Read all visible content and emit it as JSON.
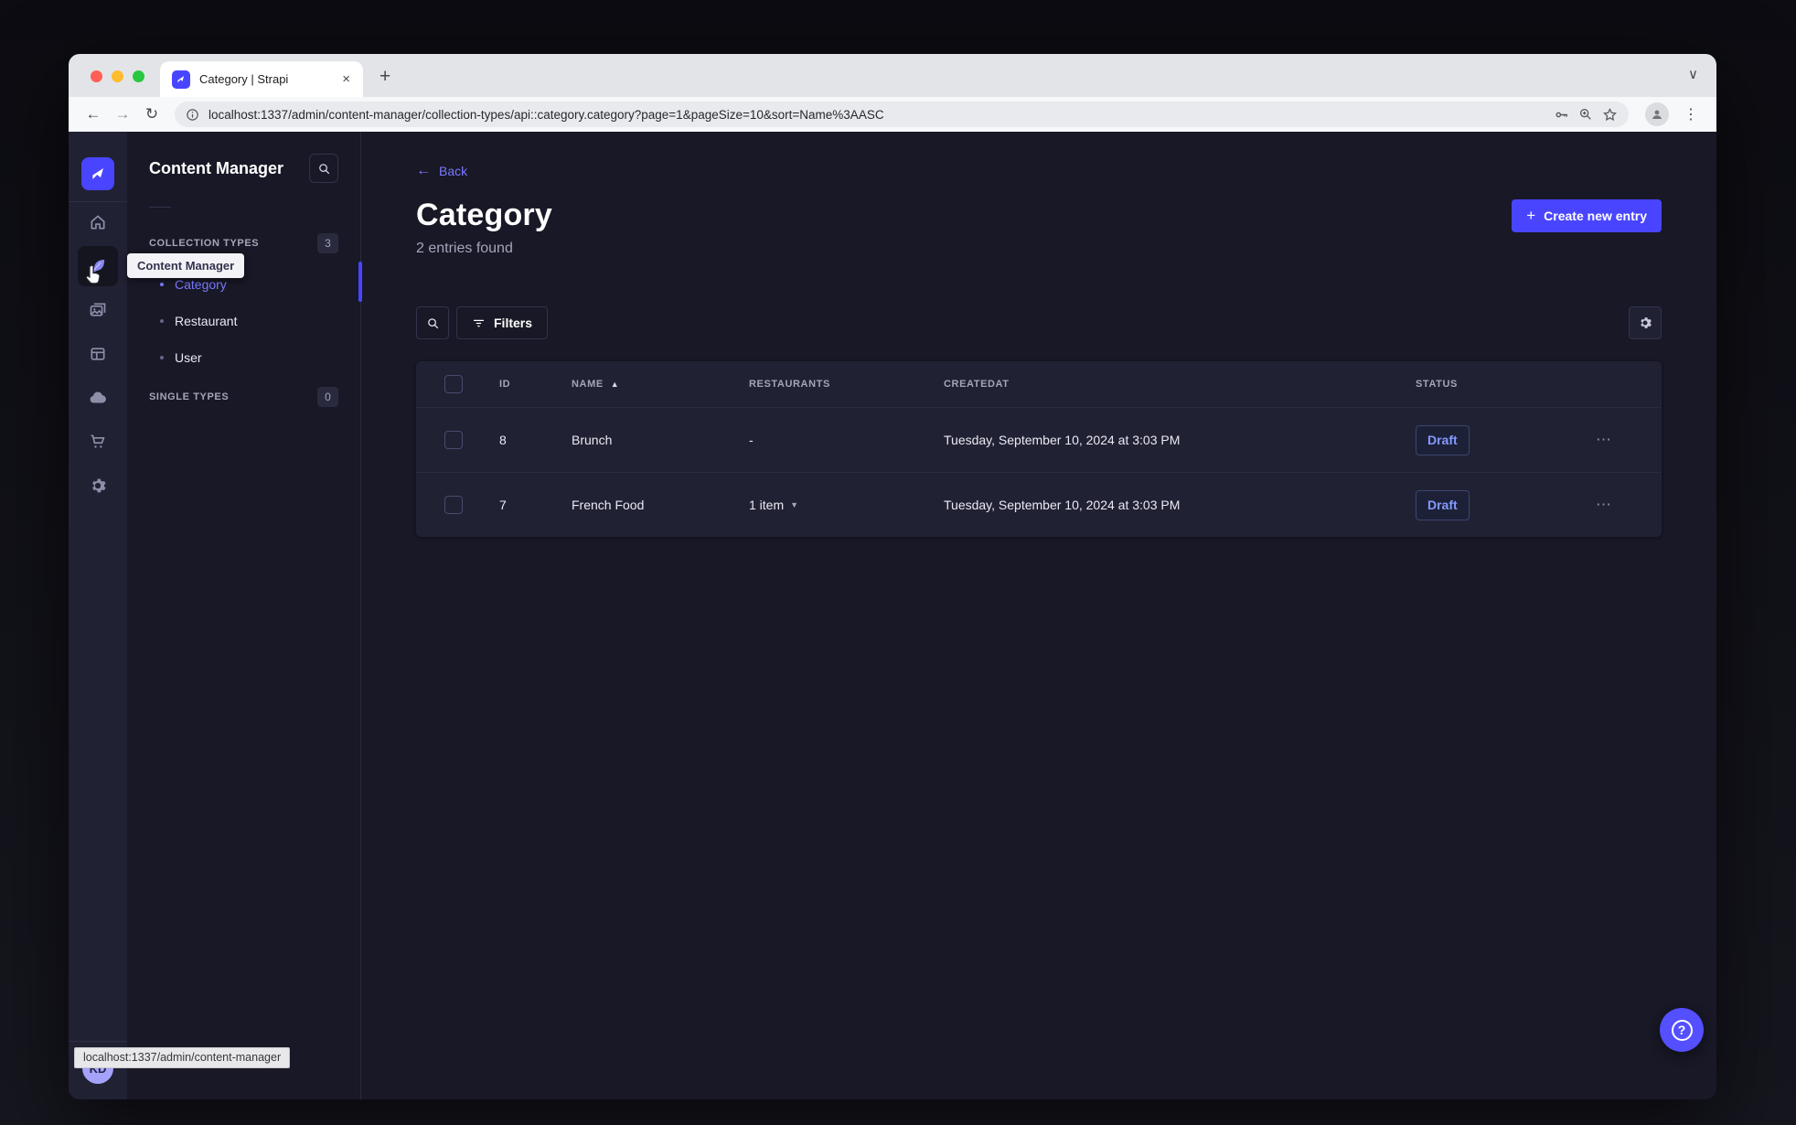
{
  "browser": {
    "tab_title": "Category | Strapi",
    "url": "localhost:1337/admin/content-manager/collection-types/api::category.category?page=1&pageSize=10&sort=Name%3AASC",
    "status_link": "localhost:1337/admin/content-manager"
  },
  "nav": {
    "tooltip": "Content Manager",
    "avatar_initials": "KD",
    "help_icon": "?"
  },
  "subnav": {
    "title": "Content Manager",
    "sections": [
      {
        "label": "COLLECTION TYPES",
        "badge": "3"
      },
      {
        "label": "SINGLE TYPES",
        "badge": "0"
      }
    ],
    "collection_items": [
      {
        "label": "Category",
        "active": true
      },
      {
        "label": "Restaurant",
        "active": false
      },
      {
        "label": "User",
        "active": false
      }
    ]
  },
  "main": {
    "back_label": "Back",
    "title": "Category",
    "entries_count": "2 entries found",
    "create_button_label": "Create new entry",
    "filters_button_label": "Filters",
    "table": {
      "columns": [
        "ID",
        "NAME",
        "RESTAURANTS",
        "CREATEDAT",
        "STATUS"
      ],
      "sort": {
        "column": "NAME",
        "direction": "asc"
      },
      "rows": [
        {
          "id": "8",
          "name": "Brunch",
          "restaurants": "-",
          "createdAt": "Tuesday, September 10, 2024 at 3:03 PM",
          "status": "Draft"
        },
        {
          "id": "7",
          "name": "French Food",
          "restaurants": "1 item",
          "createdAt": "Tuesday, September 10, 2024 at 3:03 PM",
          "status": "Draft"
        }
      ]
    }
  },
  "colors": {
    "primary": "#4945ff",
    "active_link": "#7b79ff",
    "draft_text": "#8499ff",
    "app_bg": "#181826",
    "surface": "#212134"
  }
}
